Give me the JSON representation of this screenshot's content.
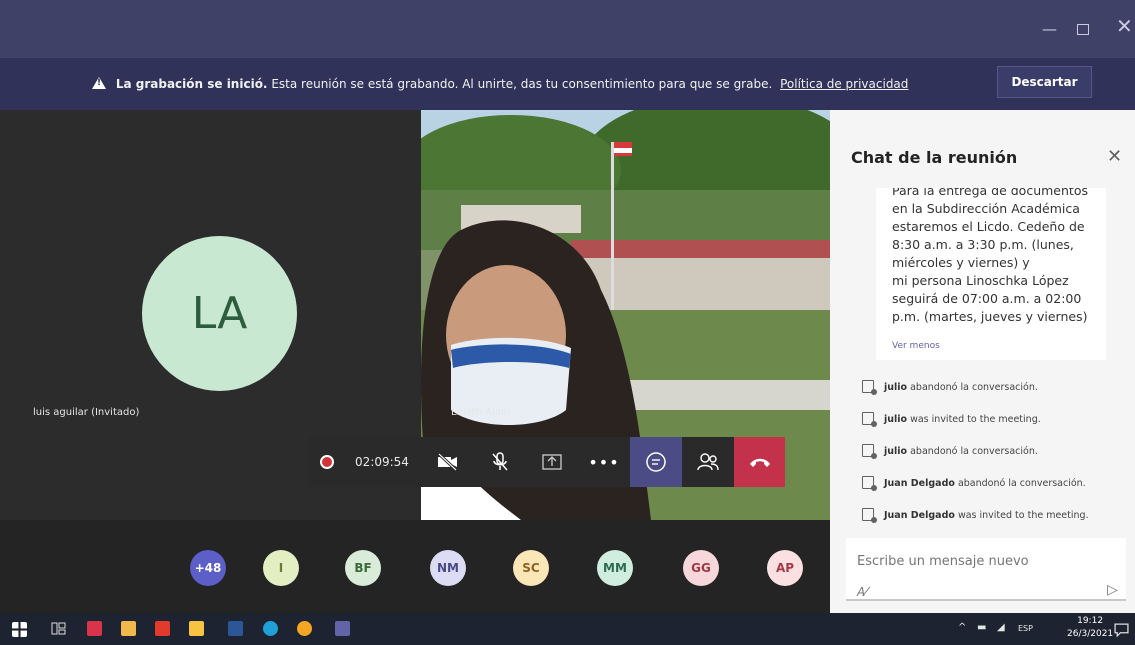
{
  "window": {
    "minimize": "—",
    "close": "✕"
  },
  "banner": {
    "bold_text": "La grabación se inició.",
    "text": "Esta reunión se está grabando. Al unirte, das tu consentimiento para que se grabe.",
    "link": "Política de privacidad",
    "dismiss": "Descartar"
  },
  "stage": {
    "left_tile": {
      "initials": "LA",
      "name": "luis aguilar (Invitado)"
    },
    "right_tile": {
      "name": "Lineth Alain"
    }
  },
  "controls": {
    "timer": "02:09:54"
  },
  "participants": [
    {
      "label": "+48",
      "bg": "#5b5fc7",
      "fg": "#ffffff"
    },
    {
      "label": "I",
      "bg": "#e3efc2",
      "fg": "#6b7a2f"
    },
    {
      "label": "BF",
      "bg": "#d9ecd9",
      "fg": "#3a6a3a"
    },
    {
      "label": "NM",
      "bg": "#dcdcf5",
      "fg": "#4a4a8a"
    },
    {
      "label": "SC",
      "bg": "#fbe6b8",
      "fg": "#8a6420"
    },
    {
      "label": "MM",
      "bg": "#cfeee0",
      "fg": "#2f6b52"
    },
    {
      "label": "GG",
      "bg": "#f7d7da",
      "fg": "#9a3a44"
    },
    {
      "label": "AP",
      "bg": "#fbe0e2",
      "fg": "#a83a48"
    }
  ],
  "chat": {
    "title": "Chat de la reunión",
    "close": "✕",
    "message": "Para la entrega de documentos\nen la Subdirección Académica\nestaremos el Licdo. Cedeño de\n8:30 a.m. a 3:30 p.m. (lunes,\nmiércoles y viernes) y\nmi persona Linoschka López\nseguirá de 07:00 a.m. a 02:00\np.m. (martes, jueves y viernes)",
    "see_less": "Ver menos",
    "events": [
      {
        "name": "julio",
        "text": "abandonó la conversación."
      },
      {
        "name": "julio",
        "text": "was invited to the meeting."
      },
      {
        "name": "julio",
        "text": "abandonó la conversación."
      },
      {
        "name": "Juan Delgado",
        "text": "abandonó la conversación."
      },
      {
        "name": "Juan Delgado",
        "text": "was invited to the meeting."
      }
    ],
    "compose_placeholder": "Escribe un mensaje nuevo"
  },
  "taskbar": {
    "lang": "ESP",
    "time": "19:12",
    "date": "26/3/2021"
  },
  "colors": {
    "accent": "#6264a7",
    "titlebar": "#3f4166",
    "banner": "#30325a",
    "hangup": "#c4314b"
  }
}
